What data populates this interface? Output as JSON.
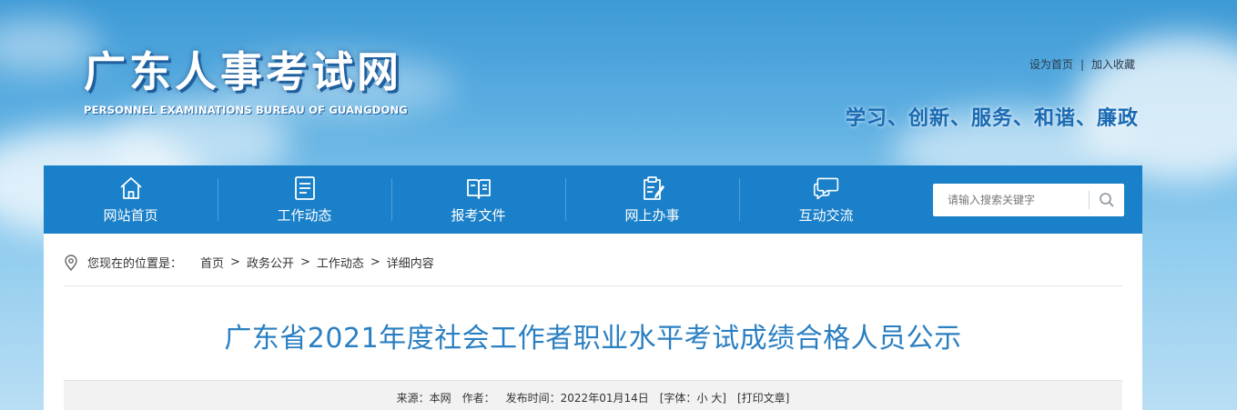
{
  "header": {
    "logo_cn": "广东人事考试网",
    "logo_en": "PERSONNEL EXAMINATIONS BUREAU OF GUANGDONG",
    "top_links": {
      "set_home": "设为首页",
      "separator": "|",
      "add_favorite": "加入收藏"
    },
    "slogan": "学习、创新、服务、和谐、廉政"
  },
  "nav": {
    "items": [
      {
        "label": "网站首页",
        "icon": "home-icon"
      },
      {
        "label": "工作动态",
        "icon": "document-list-icon"
      },
      {
        "label": "报考文件",
        "icon": "open-book-icon"
      },
      {
        "label": "网上办事",
        "icon": "clipboard-pen-icon"
      },
      {
        "label": "互动交流",
        "icon": "chat-bubbles-icon"
      }
    ],
    "search": {
      "placeholder": "请输入搜索关键字",
      "icon": "search-icon"
    }
  },
  "breadcrumb": {
    "prefix": "您现在的位置是：",
    "items": [
      "首页",
      "政务公开",
      "工作动态",
      "详细内容"
    ],
    "separator": ">"
  },
  "article": {
    "title": "广东省2021年度社会工作者职业水平考试成绩合格人员公示",
    "meta": {
      "source": "来源：本网",
      "author": "作者：",
      "date": "发布时间：2022年01月14日",
      "font_prefix": "[字体：",
      "font_small": "小",
      "font_large": "大",
      "font_suffix": "]",
      "print": "[打印文章]"
    }
  },
  "colors": {
    "nav_bg": "#1a80c9",
    "title": "#2a7fc2",
    "slogan": "#1a6ab3"
  }
}
